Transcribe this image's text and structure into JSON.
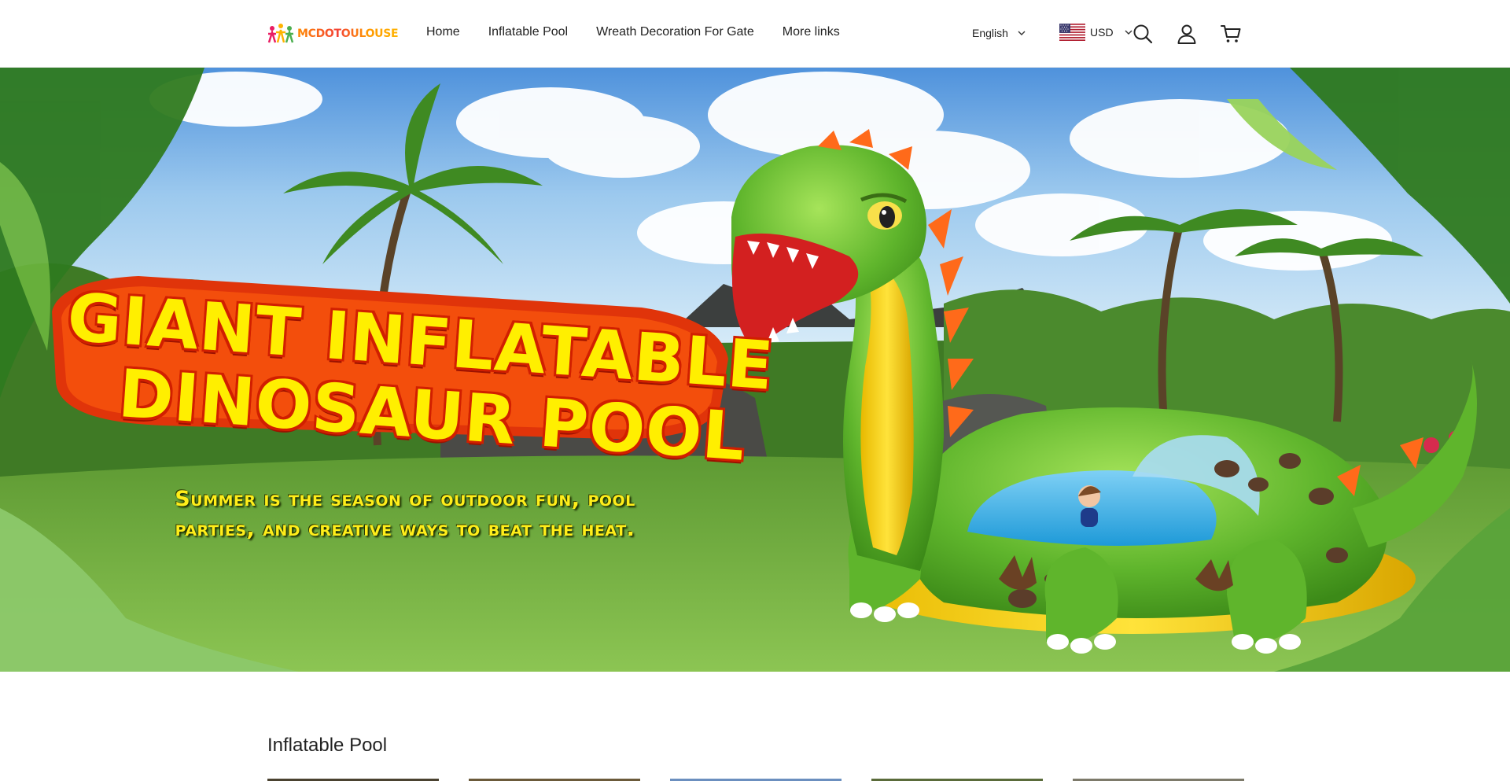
{
  "brand": {
    "logo_text": "MCDOTOULOUSE"
  },
  "nav": {
    "items": [
      {
        "label": "Home"
      },
      {
        "label": "Inflatable Pool"
      },
      {
        "label": "Wreath Decoration For Gate"
      },
      {
        "label": "More links"
      }
    ]
  },
  "header": {
    "language": "English",
    "currency": "USD",
    "icons": [
      "search-icon",
      "account-icon",
      "cart-icon"
    ]
  },
  "hero": {
    "title_line1": "GIANT INFLATABLE",
    "title_line2": "DINOSAUR POOL",
    "subtitle_line1": "Summer is the season of outdoor fun, pool",
    "subtitle_line2": "parties, and creative ways to beat the heat."
  },
  "section": {
    "title": "Inflatable Pool"
  },
  "colors": {
    "title_fill": "#ffef00",
    "title_outline": "#d11f00",
    "dino_green": "#6cc334",
    "dino_yellow": "#f6d21a"
  }
}
